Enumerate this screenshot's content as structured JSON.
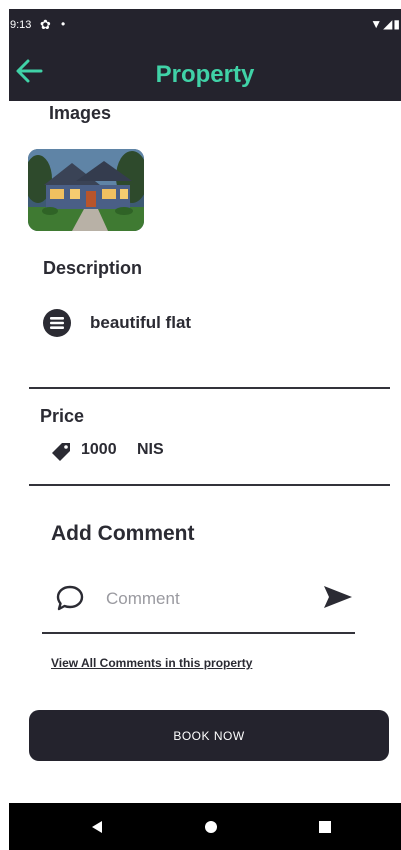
{
  "status_bar": {
    "time": "9:13",
    "gear": "✿",
    "dot": "•",
    "system_icons": "▼◢▮"
  },
  "header": {
    "title": "Property"
  },
  "images": {
    "label": "Images"
  },
  "description": {
    "label": "Description",
    "text": "beautiful flat"
  },
  "price": {
    "label": "Price",
    "value": "1000",
    "currency": "NIS"
  },
  "comments": {
    "heading": "Add Comment",
    "input_value": "",
    "input_placeholder": "Comment",
    "view_all_link": "View All Comments in this property"
  },
  "book_button": {
    "label": "BOOK NOW"
  },
  "colors": {
    "appbar": "#24232d",
    "accent": "#40d2a7",
    "text": "#2b2b33"
  },
  "icons": {
    "back": "arrow-left-icon",
    "description": "list-icon",
    "price": "tag-icon",
    "comment": "chat-bubble-icon",
    "send": "send-icon"
  }
}
